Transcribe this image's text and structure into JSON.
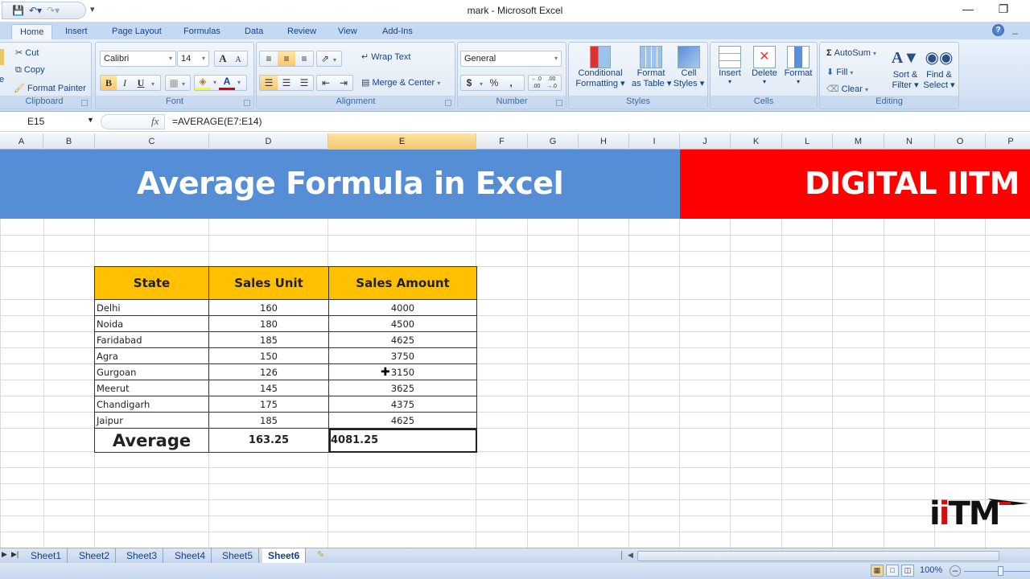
{
  "window": {
    "title": "mark - Microsoft Excel",
    "minimize_icon": "minimize-icon",
    "restore_icon": "restore-icon"
  },
  "quick_access": {
    "items": [
      "save-icon",
      "undo-icon",
      "redo-icon"
    ],
    "customize": "▾"
  },
  "ribbon_tabs": [
    "Home",
    "Insert",
    "Page Layout",
    "Formulas",
    "Data",
    "Review",
    "View",
    "Add-Ins"
  ],
  "active_tab": "Home",
  "ribbon": {
    "clipboard": {
      "label": "Clipboard",
      "paste_suffix": "e",
      "cut": "Cut",
      "copy": "Copy",
      "format_painter": "Format Painter"
    },
    "font": {
      "label": "Font",
      "font_name": "Calibri",
      "font_size": "14",
      "bold": "B",
      "italic": "I",
      "underline": "U",
      "grow": "A",
      "shrink": "A"
    },
    "alignment": {
      "label": "Alignment",
      "wrap_text": "Wrap Text",
      "merge_center": "Merge & Center"
    },
    "number": {
      "label": "Number",
      "format": "General",
      "currency": "$",
      "percent": "%",
      "comma": ",",
      "inc_decimal": "←.0 .00",
      "dec_decimal": ".00 →.0"
    },
    "styles": {
      "label": "Styles",
      "conditional_1": "Conditional",
      "conditional_2": "Formatting",
      "format_table_1": "Format",
      "format_table_2": "as Table",
      "cell_styles_1": "Cell",
      "cell_styles_2": "Styles"
    },
    "cells": {
      "label": "Cells",
      "insert": "Insert",
      "delete": "Delete",
      "format": "Format"
    },
    "editing": {
      "label": "Editing",
      "autosum": "AutoSum",
      "fill": "Fill",
      "clear": "Clear",
      "sort_1": "Sort &",
      "sort_2": "Filter",
      "find_1": "Find &",
      "find_2": "Select"
    }
  },
  "formula_bar": {
    "name_box": "E15",
    "fx": "fx",
    "formula": "=AVERAGE(E7:E14)"
  },
  "columns": [
    "A",
    "B",
    "C",
    "D",
    "E",
    "F",
    "G",
    "H",
    "I",
    "J",
    "K",
    "L",
    "M",
    "N",
    "O",
    "P"
  ],
  "selected_column": "E",
  "banner": {
    "title": "Average Formula in Excel",
    "brand": "DIGITAL IITM",
    "title_bg": "#558ED5",
    "brand_bg": "#FF0000"
  },
  "table": {
    "headers": [
      "State",
      "Sales Unit",
      "Sales Amount"
    ],
    "header_bg": "#FFC000",
    "rows": [
      {
        "state": "Delhi",
        "unit": "160",
        "amount": "4000"
      },
      {
        "state": "Noida",
        "unit": "180",
        "amount": "4500"
      },
      {
        "state": "Faridabad",
        "unit": "185",
        "amount": "4625"
      },
      {
        "state": "Agra",
        "unit": "150",
        "amount": "3750"
      },
      {
        "state": "Gurgoan",
        "unit": "126",
        "amount": "3150"
      },
      {
        "state": "Meerut",
        "unit": "145",
        "amount": "3625"
      },
      {
        "state": "Chandigarh",
        "unit": "175",
        "amount": "4375"
      },
      {
        "state": "Jaipur",
        "unit": "185",
        "amount": "4625"
      }
    ],
    "average": {
      "label": "Average",
      "unit": "163.25",
      "amount": "4081.25"
    }
  },
  "logo": {
    "i1": "i",
    "i2": "i",
    "tm": "TM"
  },
  "sheets": [
    "Sheet1",
    "Sheet2",
    "Sheet3",
    "Sheet4",
    "Sheet5",
    "Sheet6"
  ],
  "active_sheet": "Sheet6",
  "status": {
    "zoom": "100%"
  }
}
